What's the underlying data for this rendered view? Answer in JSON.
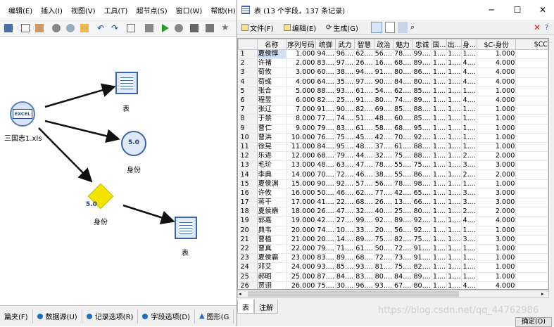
{
  "left_app": {
    "menu": [
      "编辑(E)",
      "插入(I)",
      "视图(V)",
      "工具(T)",
      "超节点(S)",
      "窗口(W)",
      "帮助(H)"
    ],
    "nodes": {
      "source": "三国志1.xls",
      "table1": "表",
      "type1": "身份",
      "type2": "身份",
      "table2": "表"
    },
    "source_icon_text": "EXCEL",
    "type_badge": "5.0",
    "tabs": [
      "篇夹(F)",
      "数据源(U)",
      "记录选项(R)",
      "字段选项(D)",
      "图形(G"
    ]
  },
  "window": {
    "title": "表 (13 个字段，137 条记录)",
    "toolbar": {
      "file": "文件(F)",
      "edit": "编辑(E)",
      "generate": "生成(G)"
    },
    "columns": [
      "名称",
      "序列号码",
      "统御",
      "武力",
      "智慧",
      "政治",
      "魅力",
      "忠诚",
      "国...",
      "出...",
      "身...",
      "$C-身份",
      "$CC"
    ],
    "rows": [
      [
        "1",
        "夏侯惇",
        "1.000",
        "94....",
        "96....",
        "62....",
        "56....",
        "78....",
        "99....",
        "1....",
        "1....",
        "1....",
        "1.000",
        ""
      ],
      [
        "2",
        "许褚",
        "2.000",
        "83....",
        "97....",
        "26....",
        "16....",
        "68....",
        "89....",
        "1....",
        "1....",
        "4....",
        "4.000",
        ""
      ],
      [
        "3",
        "荀攸",
        "3.000",
        "60....",
        "38....",
        "94....",
        "91....",
        "80....",
        "86....",
        "1....",
        "1....",
        "4....",
        "4.000",
        ""
      ],
      [
        "4",
        "荀彧",
        "4.000",
        "64....",
        "35....",
        "97....",
        "90....",
        "84....",
        "80....",
        "1....",
        "1....",
        "4....",
        "4.000",
        ""
      ],
      [
        "5",
        "张合",
        "5.000",
        "88....",
        "93....",
        "61....",
        "54....",
        "62....",
        "85....",
        "1....",
        "1....",
        "1....",
        "1.000",
        ""
      ],
      [
        "6",
        "程昱",
        "6.000",
        "82....",
        "25....",
        "91....",
        "80....",
        "74....",
        "89....",
        "1....",
        "1....",
        "4....",
        "4.000",
        ""
      ],
      [
        "7",
        "张辽",
        "7.000",
        "91....",
        "90....",
        "82....",
        "69....",
        "85....",
        "88....",
        "1....",
        "1....",
        "1....",
        "1.000",
        ""
      ],
      [
        "8",
        "于禁",
        "8.000",
        "77....",
        "74....",
        "51....",
        "48....",
        "60....",
        "85....",
        "1....",
        "1....",
        "1....",
        "1.000",
        ""
      ],
      [
        "9",
        "曹仁",
        "9.000",
        "79....",
        "83....",
        "61....",
        "58....",
        "68....",
        "95....",
        "1....",
        "1....",
        "1....",
        "1.000",
        ""
      ],
      [
        "10",
        "曹洪",
        "10.000",
        "76....",
        "75....",
        "45....",
        "42....",
        "70....",
        "92....",
        "1....",
        "1....",
        "1....",
        "1.000",
        ""
      ],
      [
        "11",
        "徐晃",
        "11.000",
        "84....",
        "95....",
        "48....",
        "37....",
        "61....",
        "88....",
        "1....",
        "1....",
        "1....",
        "1.000",
        ""
      ],
      [
        "12",
        "乐进",
        "12.000",
        "68....",
        "79....",
        "44....",
        "32....",
        "75....",
        "88....",
        "1....",
        "1....",
        "2....",
        "2.000",
        ""
      ],
      [
        "13",
        "毛玠",
        "13.000",
        "48....",
        "63....",
        "47....",
        "78....",
        "55....",
        "75....",
        "1....",
        "1....",
        "3....",
        "3.000",
        ""
      ],
      [
        "14",
        "李典",
        "14.000",
        "70....",
        "72....",
        "46....",
        "38....",
        "55....",
        "86....",
        "1....",
        "1....",
        "2....",
        "2.000",
        ""
      ],
      [
        "15",
        "夏侯渊",
        "15.000",
        "90....",
        "92....",
        "57....",
        "56....",
        "78....",
        "98....",
        "1....",
        "1....",
        "1....",
        "1.000",
        ""
      ],
      [
        "16",
        "许攸",
        "16.000",
        "50....",
        "46....",
        "62....",
        "77....",
        "42....",
        "65....",
        "1....",
        "1....",
        "3....",
        "3.000",
        ""
      ],
      [
        "17",
        "蒋干",
        "17.000",
        "41....",
        "22....",
        "68....",
        "26....",
        "13....",
        "66....",
        "1....",
        "1....",
        "3....",
        "3.000",
        ""
      ],
      [
        "18",
        "夏侯楙",
        "18.000",
        "26....",
        "47....",
        "32....",
        "40....",
        "25....",
        "80....",
        "1....",
        "1....",
        "2....",
        "2.000",
        ""
      ],
      [
        "19",
        "郭嘉",
        "19.000",
        "42....",
        "27....",
        "99....",
        "92....",
        "89....",
        "92....",
        "1....",
        "1....",
        "4....",
        "4.000",
        ""
      ],
      [
        "20",
        "典韦",
        "20.000",
        "74....",
        "10....",
        "33....",
        "20....",
        "56....",
        "92....",
        "1....",
        "1....",
        "1....",
        "1.000",
        ""
      ],
      [
        "21",
        "曹植",
        "21.000",
        "20....",
        "14....",
        "89....",
        "75....",
        "82....",
        "75....",
        "1....",
        "1....",
        "3....",
        "3.000",
        ""
      ],
      [
        "22",
        "曹真",
        "22.000",
        "79....",
        "71....",
        "61....",
        "50....",
        "72....",
        "91....",
        "1....",
        "1....",
        "1....",
        "1.000",
        ""
      ],
      [
        "23",
        "夏侯霸",
        "23.000",
        "83....",
        "89....",
        "68....",
        "72....",
        "73....",
        "91....",
        "1....",
        "1....",
        "1....",
        "1.000",
        ""
      ],
      [
        "24",
        "邓艾",
        "24.000",
        "93....",
        "85....",
        "93....",
        "81....",
        "75....",
        "82....",
        "1....",
        "1....",
        "1....",
        "1.000",
        ""
      ],
      [
        "25",
        "郝昭",
        "25.000",
        "87....",
        "84....",
        "83....",
        "80....",
        "84....",
        "89....",
        "1....",
        "1....",
        "1....",
        "1.000",
        ""
      ],
      [
        "26",
        "贾诩",
        "26.000",
        "75....",
        "30....",
        "96....",
        "93....",
        "67....",
        "80....",
        "1....",
        "1....",
        "4....",
        "4.000",
        ""
      ]
    ],
    "bottom_tabs": [
      "表",
      "注解"
    ],
    "ok_label": "确定(O)",
    "watermark": "https://blog.csdn.net/qq_44762986"
  }
}
